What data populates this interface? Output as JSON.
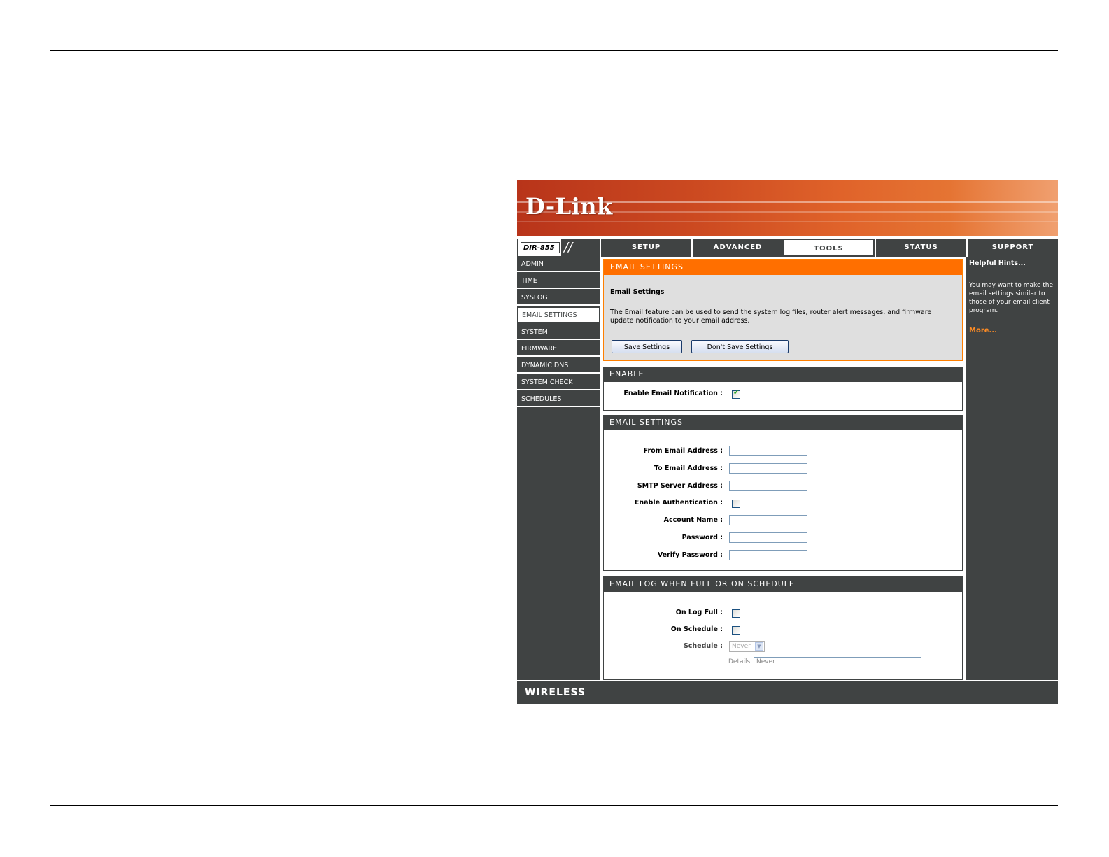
{
  "header": {
    "logo_text": "D-Link",
    "model": "DIR-855",
    "model_divider": "//"
  },
  "tabs": [
    {
      "label": "SETUP",
      "active": false
    },
    {
      "label": "ADVANCED",
      "active": false
    },
    {
      "label": "TOOLS",
      "active": true
    },
    {
      "label": "STATUS",
      "active": false
    },
    {
      "label": "SUPPORT",
      "active": false
    }
  ],
  "sidebar": {
    "items": [
      {
        "label": "ADMIN",
        "active": false
      },
      {
        "label": "TIME",
        "active": false
      },
      {
        "label": "SYSLOG",
        "active": false
      },
      {
        "label": "EMAIL SETTINGS",
        "active": true
      },
      {
        "label": "SYSTEM",
        "active": false
      },
      {
        "label": "FIRMWARE",
        "active": false
      },
      {
        "label": "DYNAMIC DNS",
        "active": false
      },
      {
        "label": "SYSTEM CHECK",
        "active": false
      },
      {
        "label": "SCHEDULES",
        "active": false
      }
    ]
  },
  "intro": {
    "header": "EMAIL SETTINGS",
    "subtitle": "Email Settings",
    "description": "The Email feature can be used to send the system log files, router alert messages, and firmware update notification to your email address.",
    "save_label": "Save Settings",
    "dont_save_label": "Don't Save Settings"
  },
  "enable_section": {
    "header": "ENABLE",
    "label": "Enable Email Notification :",
    "checked": true
  },
  "email_section": {
    "header": "EMAIL SETTINGS",
    "from_label": "From Email Address :",
    "from_value": "",
    "to_label": "To Email Address :",
    "to_value": "",
    "smtp_label": "SMTP Server Address :",
    "smtp_value": "",
    "auth_label": "Enable Authentication :",
    "auth_checked": false,
    "account_label": "Account Name :",
    "account_value": "",
    "password_label": "Password :",
    "password_value": "",
    "verify_label": "Verify Password :",
    "verify_value": ""
  },
  "log_section": {
    "header": "EMAIL LOG WHEN FULL OR ON SCHEDULE",
    "on_log_full_label": "On Log Full :",
    "on_log_full_checked": false,
    "on_schedule_label": "On Schedule :",
    "on_schedule_checked": false,
    "schedule_label": "Schedule :",
    "schedule_value": "Never",
    "details_label": "Details",
    "details_value": "Never"
  },
  "hints": {
    "title": "Helpful Hints...",
    "text": "You may want to make the email settings similar to those of your email client program.",
    "more_label": "More..."
  },
  "footer": {
    "brand": "WIRELESS"
  },
  "colors": {
    "nav_dark": "#404343",
    "accent_orange": "#ff6f00",
    "hint_link": "#ff8c24",
    "banner_red": "#c8421e"
  }
}
